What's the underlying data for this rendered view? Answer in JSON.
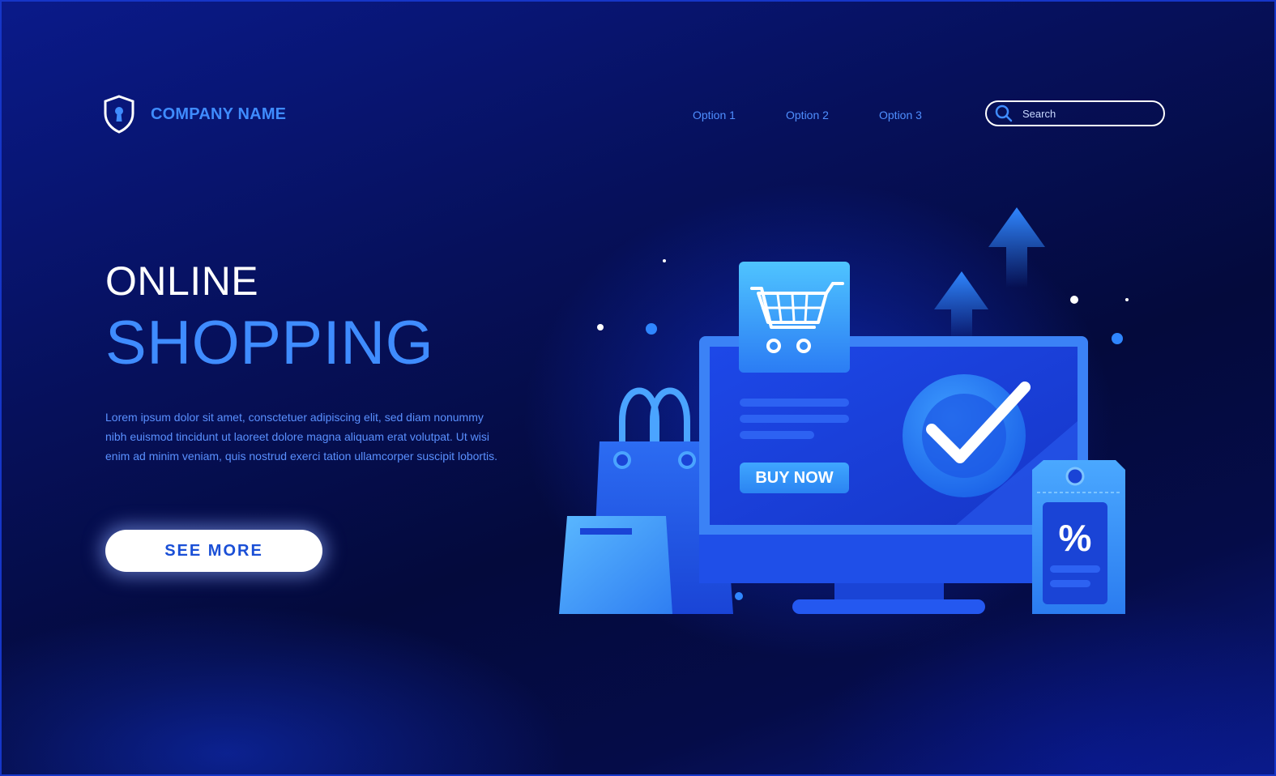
{
  "header": {
    "company_name": "COMPANY NAME",
    "logo_icon": "shield-keyhole-icon",
    "nav": [
      {
        "label": "Option 1"
      },
      {
        "label": "Option 2"
      },
      {
        "label": "Option 3"
      }
    ],
    "search": {
      "placeholder": "Search",
      "icon": "search-icon"
    }
  },
  "hero": {
    "title_line1": "ONLINE",
    "title_line2": "SHOPPING",
    "body": "Lorem ipsum dolor sit amet, consctetuer adipiscing elit, sed diam nonummy nibh euismod tincidunt ut laoreet dolore magna aliquam erat volutpat. Ut wisi enim ad minim veniam, quis nostrud exerci tation ullamcorper suscipit lobortis.",
    "cta_label": "SEE MORE"
  },
  "illustration": {
    "buy_button_label": "BUY NOW",
    "tag_symbol": "%",
    "icons": [
      "shopping-cart-icon",
      "check-circle-icon",
      "shopping-bag-icon",
      "price-tag-icon",
      "arrow-up-icon"
    ]
  },
  "colors": {
    "background": "#050c48",
    "accent": "#3f8cff",
    "text_white": "#ffffff",
    "button_bg": "#ffffff",
    "button_text": "#1a4fd6"
  }
}
